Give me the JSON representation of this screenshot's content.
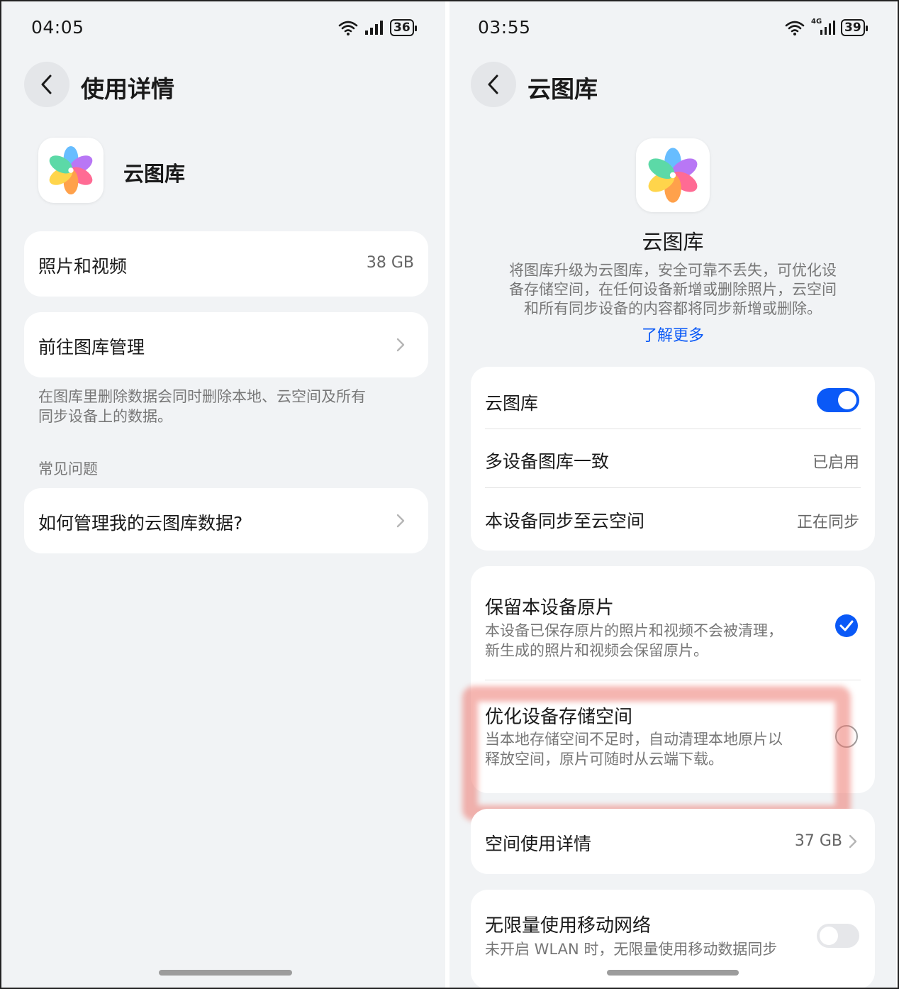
{
  "left": {
    "status": {
      "time": "04:05",
      "battery": "36"
    },
    "header": {
      "title": "使用详情"
    },
    "app": {
      "name": "云图库"
    },
    "photos_row": {
      "label": "照片和视频",
      "value": "38 GB"
    },
    "manage_row": {
      "label": "前往图库管理"
    },
    "delete_note": {
      "line1": "在图库里删除数据会同时删除本地、云空间及所有",
      "line2": "同步设备上的数据。"
    },
    "faq": {
      "heading": "常见问题",
      "item": "如何管理我的云图库数据?"
    }
  },
  "right": {
    "status": {
      "time": "03:55",
      "network": "4G",
      "battery": "39"
    },
    "header": {
      "title": "云图库"
    },
    "app": {
      "name": "云图库",
      "description_line1": "将图库升级为云图库，安全可靠不丢失，可优化设",
      "description_line2": "备存储空间，在任何设备新增或删除照片，云空间",
      "description_line3": "和所有同步设备的内容都将同步新增或删除。",
      "learn_more": "了解更多"
    },
    "settings": {
      "gallery_toggle_label": "云图库",
      "gallery_toggle_on": true,
      "consistency_label": "多设备图库一致",
      "consistency_value": "已启用",
      "sync_label": "本设备同步至云空间",
      "sync_value": "正在同步"
    },
    "storage_options": {
      "keep": {
        "title": "保留本设备原片",
        "line1": "本设备已保存原片的照片和视频不会被清理，",
        "line2": "新生成的照片和视频会保留原片。",
        "selected": true
      },
      "optimize": {
        "title": "优化设备存储空间",
        "line1": "当本地存储空间不足时，自动清理本地原片以",
        "line2": "释放空间，原片可随时从云端下载。",
        "selected": false
      }
    },
    "space_row": {
      "label": "空间使用详情",
      "value": "37 GB"
    },
    "mobile_data": {
      "label": "无限量使用移动网络",
      "desc": "未开启 WLAN 时，无限量使用移动数据同步",
      "enabled": false
    }
  },
  "colors": {
    "accent": "#0a59f7",
    "link": "#0a59f7",
    "highlight": "#ec7870"
  },
  "icons": [
    "back-arrow-icon",
    "wifi-icon",
    "signal-icon",
    "battery-icon",
    "chevron-right-icon",
    "checkmark-icon",
    "gallery-flower-icon"
  ]
}
